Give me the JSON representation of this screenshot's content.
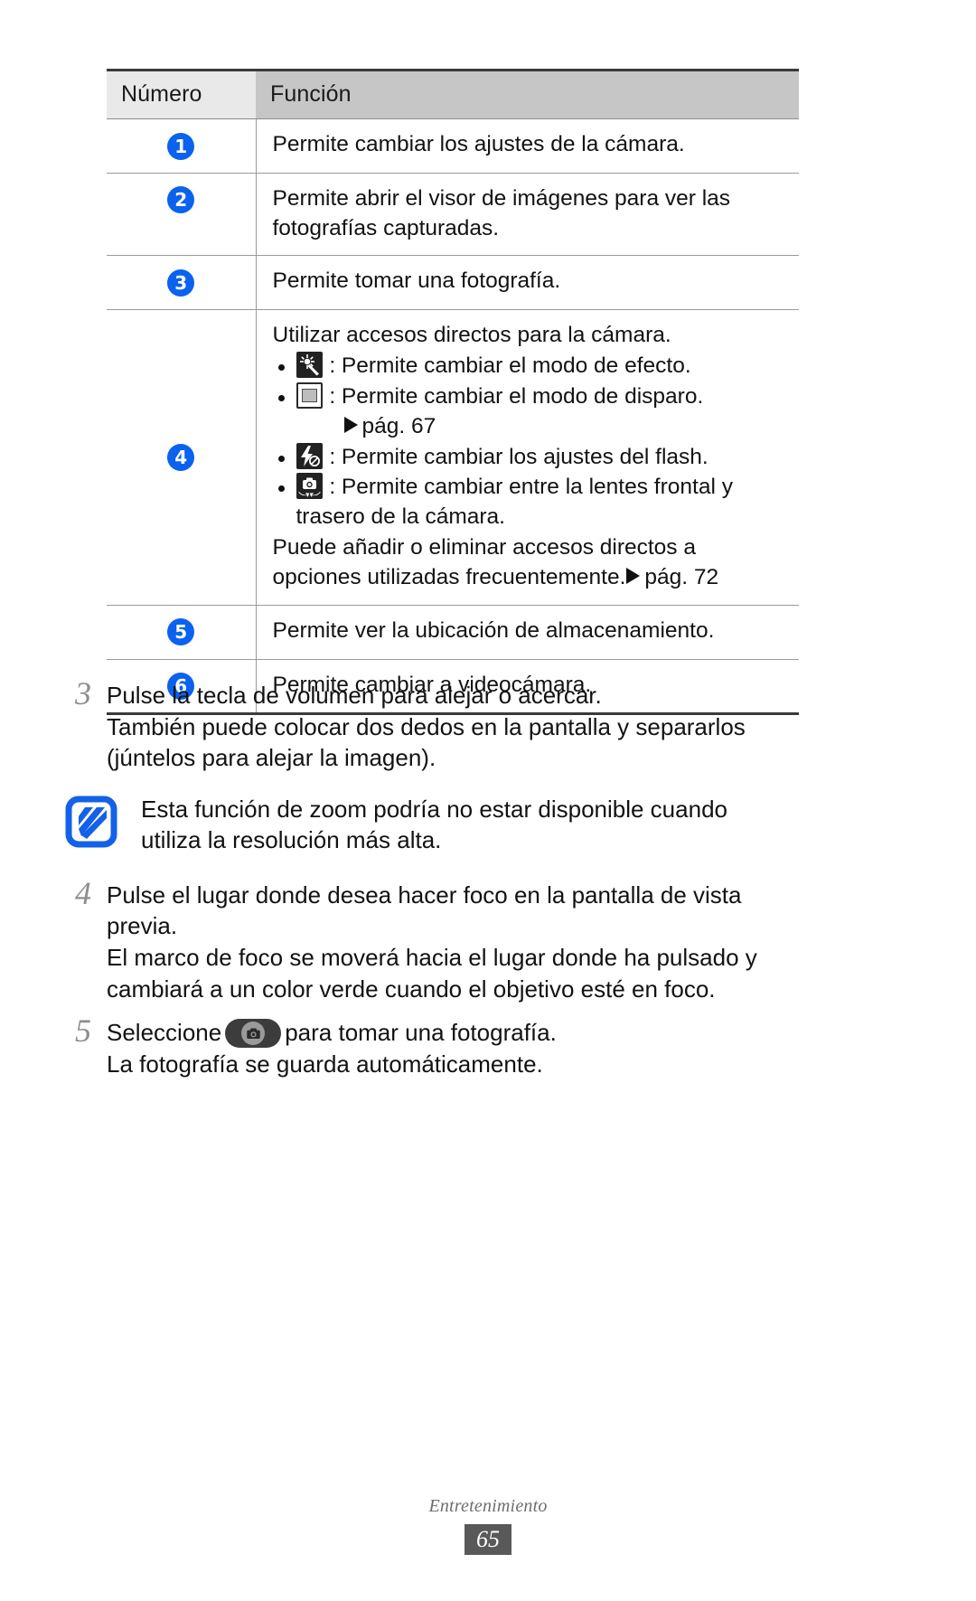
{
  "table": {
    "headers": [
      "Número",
      "Función"
    ],
    "rows": [
      {
        "num": "1",
        "text": "Permite cambiar los ajustes de la cámara."
      },
      {
        "num": "2",
        "text": "Permite abrir el visor de imágenes para ver las fotografías capturadas."
      },
      {
        "num": "3",
        "text": "Permite tomar una fotografía."
      },
      {
        "num": "4",
        "intro": "Utilizar accesos directos para la cámara.",
        "bullets": [
          {
            "icon": "effect-mode-icon",
            "text": ": Permite cambiar el modo de efecto."
          },
          {
            "icon": "shooting-mode-icon",
            "text": ": Permite cambiar el modo de disparo.",
            "ref": "pág. 67"
          },
          {
            "icon": "flash-off-icon",
            "text": ": Permite cambiar los ajustes del flash."
          },
          {
            "icon": "switch-camera-icon",
            "text": ": Permite cambiar entre la lentes frontal y",
            "cont": "trasero de la cámara."
          }
        ],
        "outro_line1": "Puede añadir o eliminar accesos directos a",
        "outro_line2": "opciones utilizadas frecuentemente.",
        "outro_ref": "pág. 72"
      },
      {
        "num": "5",
        "text": "Permite ver la ubicación de almacenamiento."
      },
      {
        "num": "6",
        "text": "Permite cambiar a videocámara."
      }
    ]
  },
  "steps": [
    {
      "number": "3",
      "line1": "Pulse la tecla de volumen para alejar o acercar.",
      "line2": "También puede colocar dos dedos en la pantalla y separarlos",
      "line3": "(júntelos para alejar la imagen)."
    },
    {
      "number": "4",
      "line1": "Pulse el lugar donde desea hacer foco en la pantalla de vista",
      "line2": "previa.",
      "line3": "El marco de foco se moverá hacia el lugar donde ha pulsado y",
      "line4": "cambiará a un color verde cuando el objetivo esté en foco."
    },
    {
      "number": "5",
      "pre": "Seleccione",
      "post": "para tomar una fotografía.",
      "line2": "La fotografía se guarda automáticamente."
    }
  ],
  "note": {
    "icon": "note-pen-icon",
    "line1": "Esta función de zoom podría no estar disponible cuando",
    "line2": "utiliza la resolución más alta."
  },
  "footer": {
    "section": "Entretenimiento",
    "page": "65"
  },
  "colors": {
    "badge_blue": "#0a62ef",
    "note_blue": "#1261e8",
    "header_num_bg": "#e9e9e9",
    "header_fn_bg": "#c6c6c6",
    "page_box": "#595959"
  }
}
